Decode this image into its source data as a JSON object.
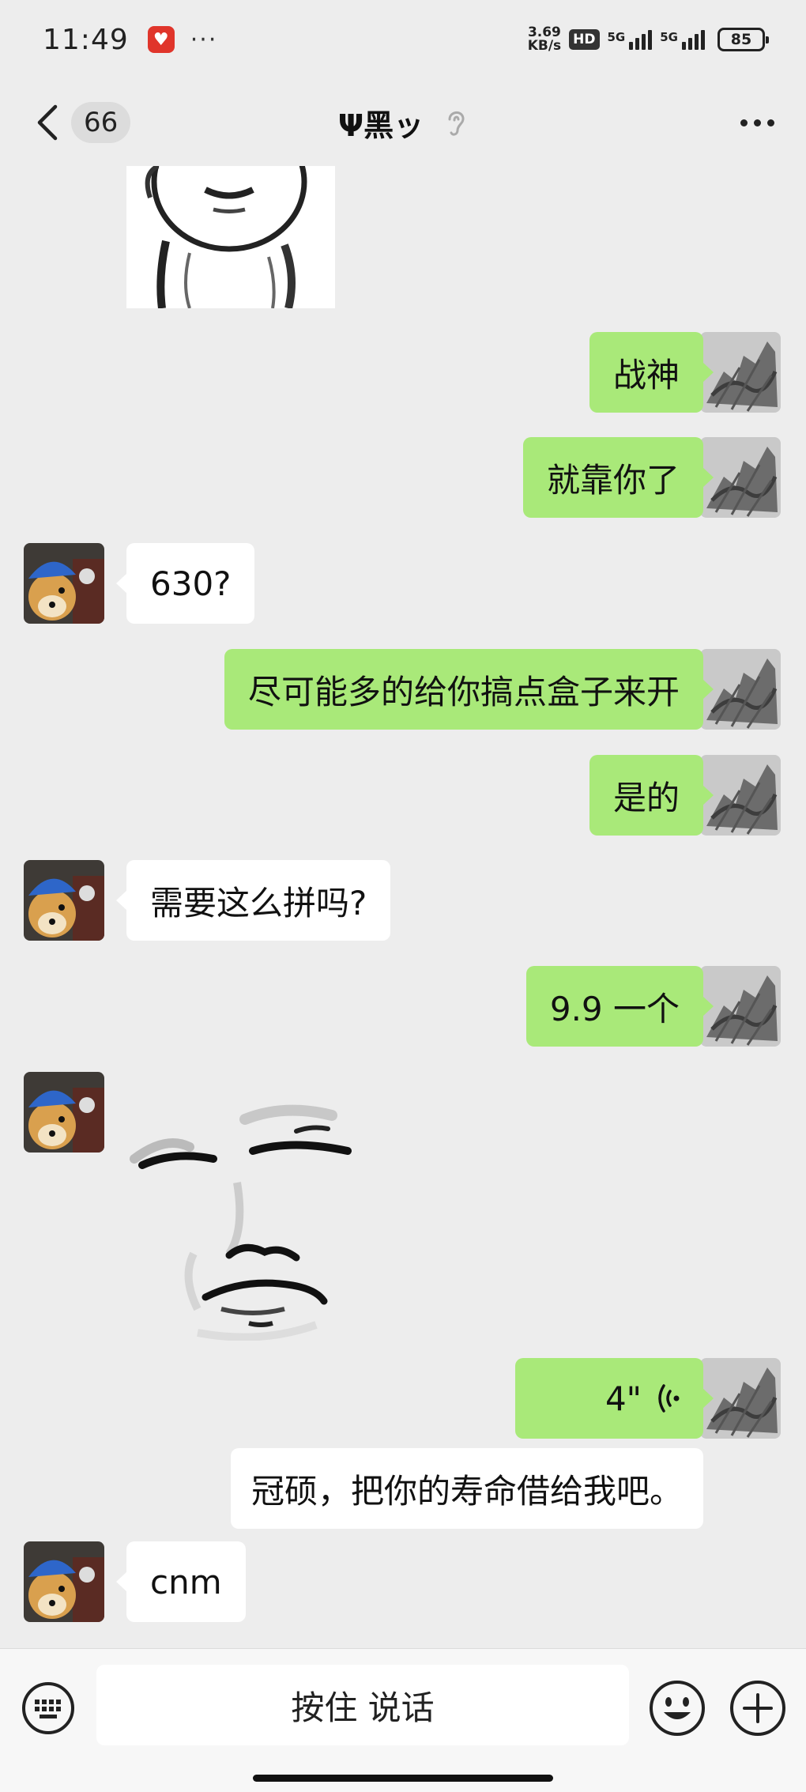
{
  "status_bar": {
    "time": "11:49",
    "dots": "···",
    "net_speed_value": "3.69",
    "net_speed_unit": "KB/s",
    "hd_label": "HD",
    "signal1_label": "5G",
    "signal2_label": "5G",
    "battery": "85"
  },
  "nav": {
    "unread_count": "66",
    "title": "Ψ黑ッ"
  },
  "messages": {
    "m1": "战神",
    "m2": "就靠你了",
    "m3": "630?",
    "m4": "尽可能多的给你搞点盒子来开",
    "m5": "是的",
    "m6": "需要这么拼吗?",
    "m7": "9.9 一个",
    "voice_duration": "4\"",
    "voice_transcript": "冠硕，把你的寿命借给我吧。",
    "m8": "cnm"
  },
  "input_bar": {
    "hold_to_talk": "按住 说话"
  },
  "colors": {
    "outgoing_bubble": "#a9e979",
    "incoming_bubble": "#ffffff",
    "background": "#ededed"
  }
}
